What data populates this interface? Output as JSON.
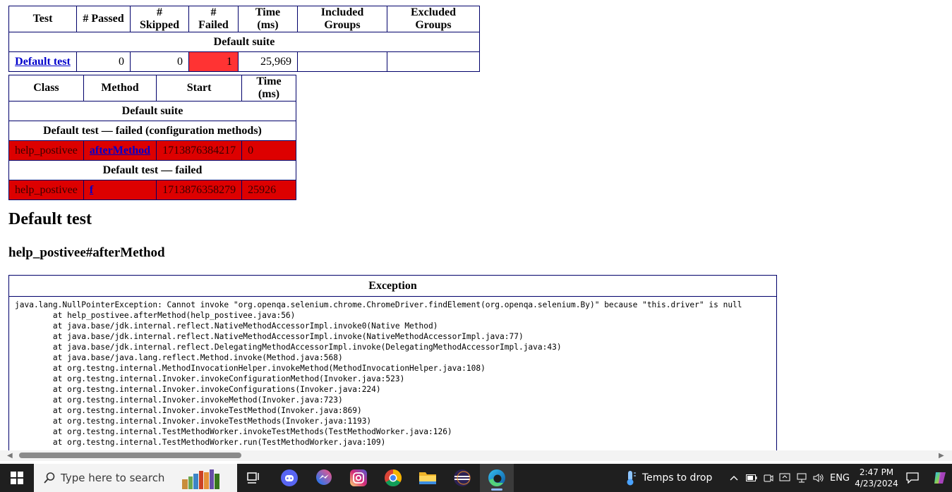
{
  "summary_table": {
    "headers": [
      "Test",
      "# Passed",
      "# Skipped",
      "# Failed",
      "Time (ms)",
      "Included Groups",
      "Excluded Groups"
    ],
    "suite_label": "Default suite",
    "row": {
      "test": "Default test",
      "passed": "0",
      "skipped": "0",
      "failed": "1",
      "time": "25,969",
      "included": "",
      "excluded": ""
    }
  },
  "methods_table": {
    "headers": [
      "Class",
      "Method",
      "Start",
      "Time (ms)"
    ],
    "suite_label": "Default suite",
    "config_section": "Default test — failed (configuration methods)",
    "config_row": {
      "class": "help_postivee",
      "method": "afterMethod",
      "start": "1713876384217",
      "time": "0"
    },
    "test_section": "Default test — failed",
    "test_row": {
      "class": "help_postivee",
      "method": "f",
      "start": "1713876358279",
      "time": "25926"
    }
  },
  "test_heading": "Default test",
  "method_heading": "help_postivee#afterMethod",
  "exception": {
    "header": "Exception",
    "trace": "java.lang.NullPointerException: Cannot invoke \"org.openqa.selenium.chrome.ChromeDriver.findElement(org.openqa.selenium.By)\" because \"this.driver\" is null\n\tat help_postivee.afterMethod(help_postivee.java:56)\n\tat java.base/jdk.internal.reflect.NativeMethodAccessorImpl.invoke0(Native Method)\n\tat java.base/jdk.internal.reflect.NativeMethodAccessorImpl.invoke(NativeMethodAccessorImpl.java:77)\n\tat java.base/jdk.internal.reflect.DelegatingMethodAccessorImpl.invoke(DelegatingMethodAccessorImpl.java:43)\n\tat java.base/java.lang.reflect.Method.invoke(Method.java:568)\n\tat org.testng.internal.MethodInvocationHelper.invokeMethod(MethodInvocationHelper.java:108)\n\tat org.testng.internal.Invoker.invokeConfigurationMethod(Invoker.java:523)\n\tat org.testng.internal.Invoker.invokeConfigurations(Invoker.java:224)\n\tat org.testng.internal.Invoker.invokeMethod(Invoker.java:723)\n\tat org.testng.internal.Invoker.invokeTestMethod(Invoker.java:869)\n\tat org.testng.internal.Invoker.invokeTestMethods(Invoker.java:1193)\n\tat org.testng.internal.TestMethodWorker.invokeTestMethods(TestMethodWorker.java:126)\n\tat org.testng.internal.TestMethodWorker.run(TestMethodWorker.java:109)"
  },
  "colors": {
    "border": "#00006a",
    "failed_cell": "#ff3333",
    "failed_row": "#dd0000",
    "link": "#0000cc",
    "taskbar": "#1f1f1f"
  },
  "taskbar": {
    "search_placeholder": "Type here to search",
    "apps": [
      "task-view-icon",
      "discord-icon",
      "messenger-icon",
      "instagram-icon",
      "chrome-icon",
      "file-explorer-icon",
      "eclipse-icon",
      "edge-icon"
    ],
    "weather_text": "Temps to drop",
    "language": "ENG",
    "time": "2:47 PM",
    "date": "4/23/2024"
  }
}
